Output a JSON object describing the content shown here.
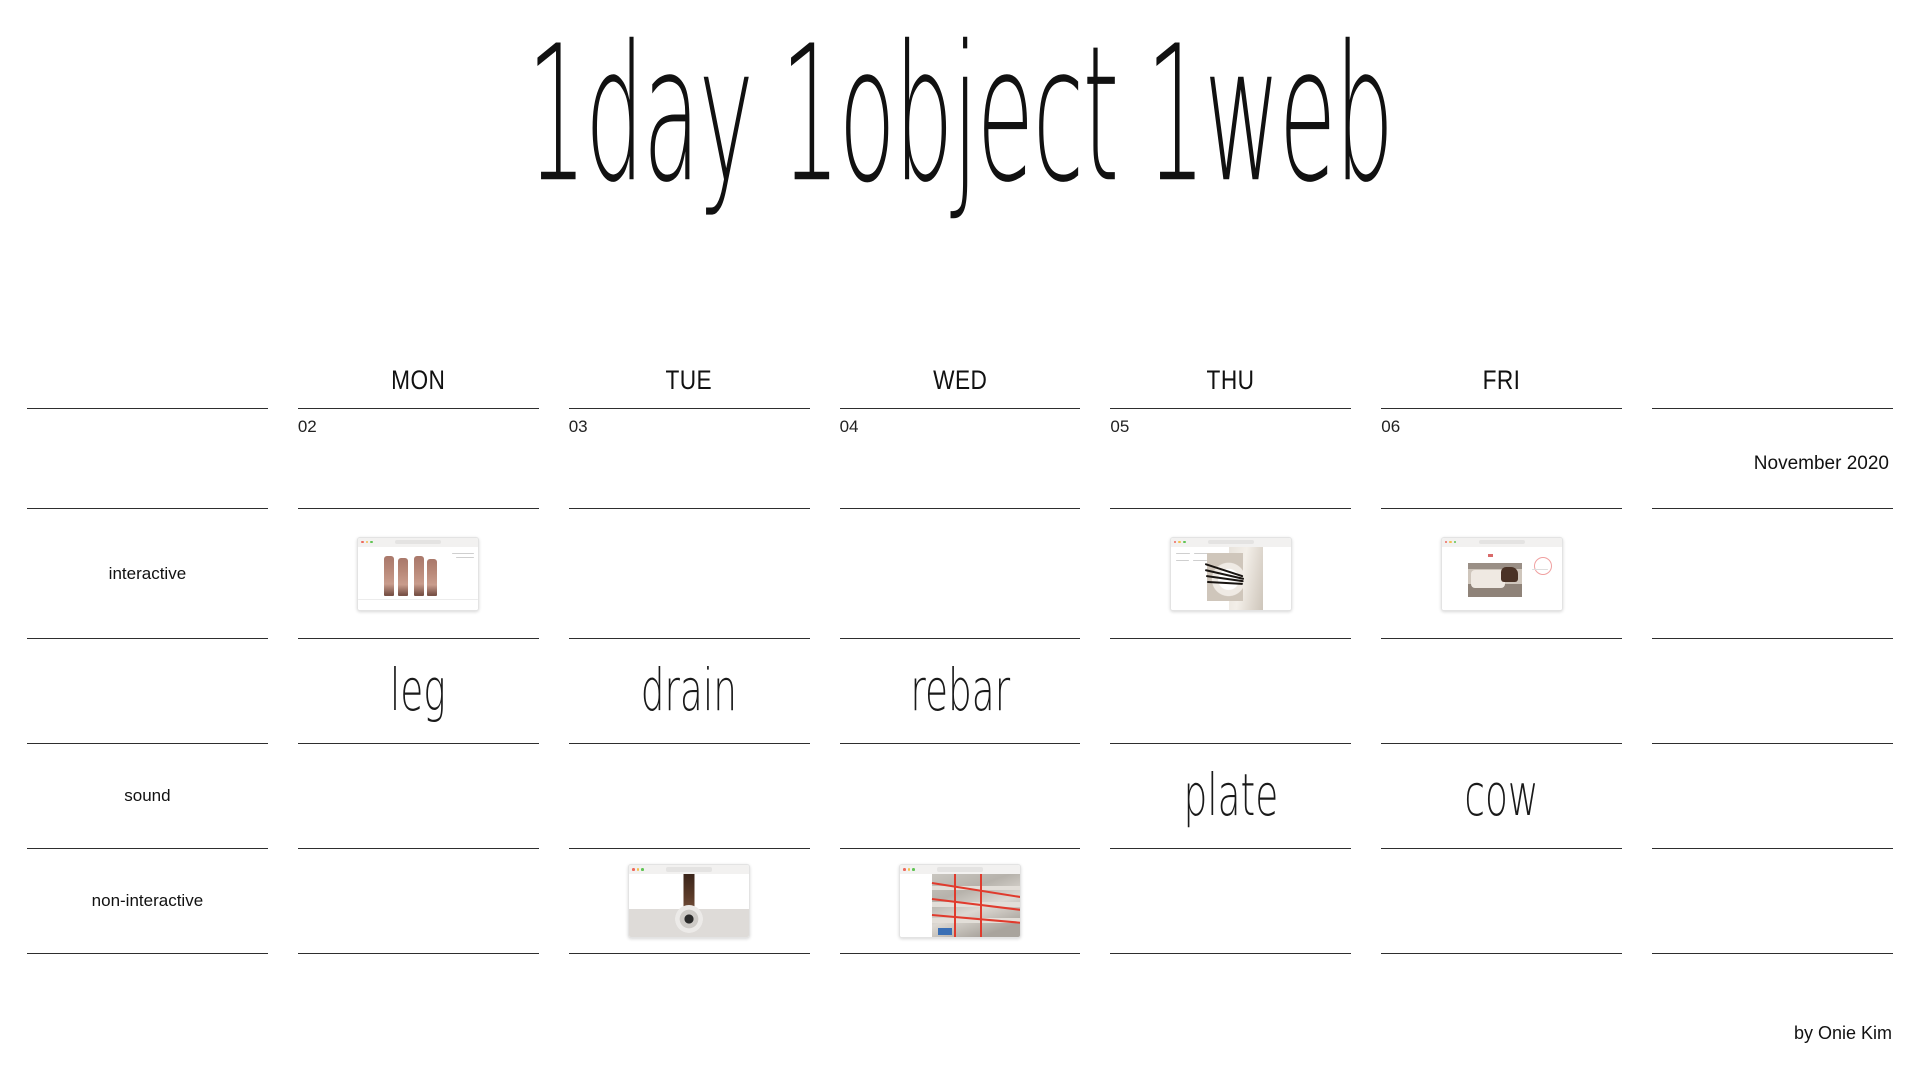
{
  "site": {
    "title": "1day 1object 1web",
    "byline": "by Onie Kim",
    "month_label": "November 2020",
    "accent_color": "#e03b2d",
    "rule_color": "#2e2e2e",
    "background": "#ffffff"
  },
  "calendar": {
    "day_headers": [
      "",
      "MON",
      "TUE",
      "WED",
      "THU",
      "FRI",
      ""
    ],
    "dates": [
      "",
      "02",
      "03",
      "04",
      "05",
      "06",
      ""
    ],
    "row_labels": {
      "interactive": "interactive",
      "sound": "sound",
      "non_interactive": "non-interactive"
    },
    "words_row_one": [
      "",
      "leg",
      "drain",
      "rebar",
      "",
      "",
      ""
    ],
    "words_row_two": [
      "",
      "",
      "",
      "",
      "plate",
      "cow",
      ""
    ],
    "thumbnails": {
      "interactive": [
        "",
        "leg-thumbnail",
        "",
        "",
        "plate-thumbnail",
        "cow-thumbnail",
        ""
      ],
      "non_interactive": [
        "",
        "",
        "drain-thumbnail",
        "rebar-thumbnail",
        "",
        "",
        ""
      ]
    },
    "entries": [
      {
        "date": "02",
        "day": "MON",
        "word": "leg",
        "kind": "interactive"
      },
      {
        "date": "03",
        "day": "TUE",
        "word": "drain",
        "kind": "non-interactive"
      },
      {
        "date": "04",
        "day": "WED",
        "word": "rebar",
        "kind": "non-interactive"
      },
      {
        "date": "05",
        "day": "THU",
        "word": "plate",
        "kind": "interactive"
      },
      {
        "date": "06",
        "day": "FRI",
        "word": "cow",
        "kind": "interactive"
      }
    ]
  }
}
